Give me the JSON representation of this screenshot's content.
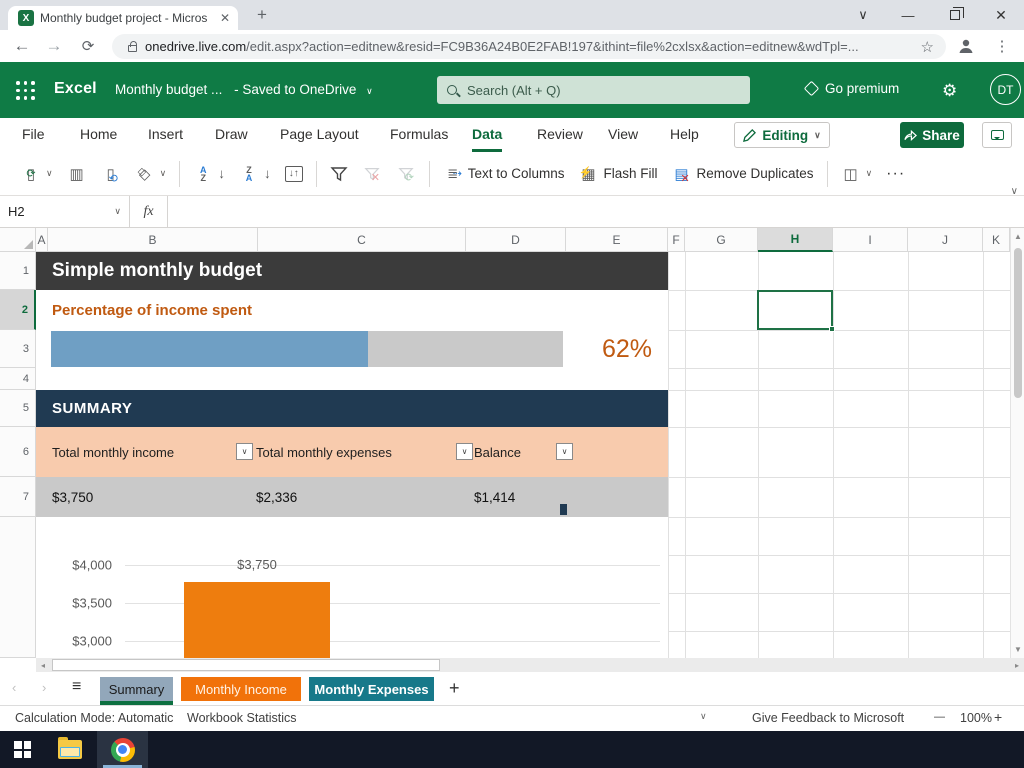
{
  "browser": {
    "tab_title": "Monthly budget project - Micros",
    "url_host": "onedrive.live.com",
    "url_path": "/edit.aspx?action=editnew&resid=FC9B36A24B0E2FAB!197&ithint=file%2cxlsx&action=editnew&wdTpl=..."
  },
  "icons": {
    "close": "✕",
    "plus": "+",
    "chevron_down": "⌄",
    "chevron_small": "∨",
    "back": "←",
    "forward": "→",
    "reload": "⟳",
    "star": "☆",
    "dots_vertical": "⋮",
    "dots_horizontal": "···",
    "gear": "⚙",
    "minimize": "—",
    "person": "●",
    "hamburger": "≡",
    "prev": "‹",
    "next": "›",
    "up": "▲",
    "down": "▼",
    "left": "◂",
    "right": "▸",
    "minus": "—"
  },
  "header": {
    "app_name": "Excel",
    "doc_title": "Monthly budget ...",
    "saved_status": "-  Saved to OneDrive",
    "search_placeholder": "Search (Alt + Q)",
    "go_premium": "Go premium",
    "avatar_initials": "DT"
  },
  "ribbon": {
    "tabs": [
      "File",
      "Home",
      "Insert",
      "Draw",
      "Page Layout",
      "Formulas",
      "Data",
      "Review",
      "View",
      "Help"
    ],
    "active_tab": "Data",
    "editing_label": "Editing",
    "share_label": "Share",
    "toolbar": {
      "text_to_columns": "Text to Columns",
      "flash_fill": "Flash Fill",
      "remove_duplicates": "Remove Duplicates"
    }
  },
  "formula_bar": {
    "name_box": "H2",
    "fx_label": "fx",
    "formula_value": ""
  },
  "grid": {
    "columns": [
      "A",
      "B",
      "C",
      "D",
      "E",
      "F",
      "G",
      "H",
      "I",
      "J",
      "K"
    ],
    "rows": [
      "1",
      "2",
      "3",
      "4",
      "5",
      "6",
      "7"
    ],
    "selected_cell": "H2",
    "selected_column": "H",
    "selected_row": "2"
  },
  "sheet": {
    "title_banner": "Simple monthly budget",
    "percentage_spent": {
      "label": "Percentage of income spent",
      "value_label": "62%",
      "percent": 62
    },
    "summary_title": "SUMMARY",
    "summary_table": {
      "headers": [
        "Total monthly income",
        "Total monthly expenses",
        "Balance"
      ],
      "values": [
        "$3,750",
        "$2,336",
        "$1,414"
      ]
    }
  },
  "chart_data": {
    "type": "bar",
    "title": "",
    "categories": [
      ""
    ],
    "values": [
      3750
    ],
    "data_labels": [
      "$3,750"
    ],
    "yticks": [
      "$4,000",
      "$3,500",
      "$3,000"
    ],
    "ylim_visible": [
      3000,
      4000
    ],
    "xlabel": "",
    "ylabel": "",
    "gridlines": true,
    "bar_color": "#ee7d0e"
  },
  "sheet_tabs": {
    "items": [
      {
        "label": "Summary",
        "color": "#92a7ba",
        "active": true
      },
      {
        "label": "Monthly Income",
        "color": "#f1720a",
        "active": false
      },
      {
        "label": "Monthly Expenses",
        "color": "#17798a",
        "active": false
      }
    ],
    "add_label": "+"
  },
  "status_bar": {
    "calc_mode": "Calculation Mode: Automatic",
    "workbook_stats": "Workbook Statistics",
    "feedback": "Give Feedback to Microsoft",
    "zoom_level": "100%"
  },
  "colors": {
    "excel_green": "#0f7b45",
    "banner_dark": "#3b3b3b",
    "accent_orange_text": "#c05a11",
    "progress_blue": "#6f9fc4",
    "summary_navy": "#203a52",
    "table_header_peach": "#f8cbad",
    "table_row_gray": "#c9c9c9",
    "chart_bar_orange": "#ee7d0e"
  }
}
